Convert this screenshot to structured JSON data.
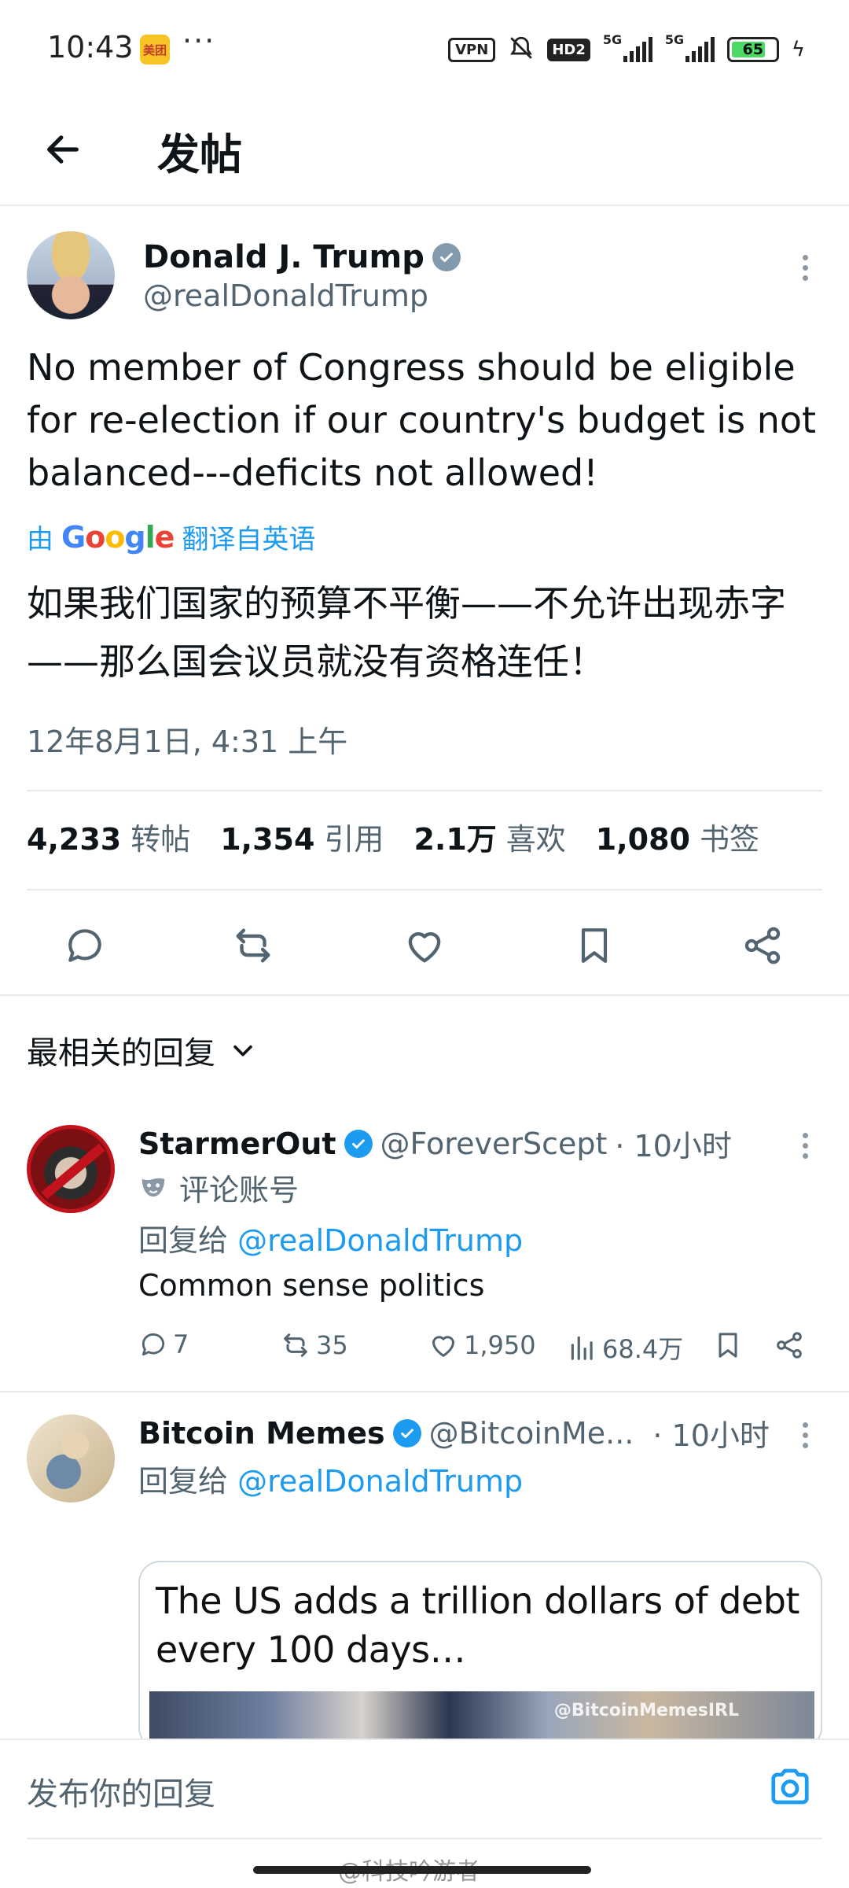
{
  "status_bar": {
    "time": "10:43",
    "app_badge": "美团",
    "more": "···",
    "vpn": "VPN",
    "hd": "HD2",
    "signal1": "5G",
    "signal2": "5G",
    "battery": "65"
  },
  "header": {
    "title": "发帖"
  },
  "tweet": {
    "author_name": "Donald J. Trump",
    "author_handle": "@realDonaldTrump",
    "text": "No member of Congress should be eligible for re-election if our country's budget is not balanced---deficits not allowed!",
    "translate_prefix": "由",
    "translate_suffix": "翻译自英语",
    "translated_text": "如果我们国家的预算不平衡——不允许出现赤字——那么国会议员就没有资格连任！",
    "timestamp": "12年8月1日, 4:31 上午",
    "stats": [
      {
        "value": "4,233",
        "label": "转帖"
      },
      {
        "value": "1,354",
        "label": "引用"
      },
      {
        "value": "2.1万",
        "label": "喜欢"
      },
      {
        "value": "1,080",
        "label": "书签"
      }
    ]
  },
  "replies_header": "最相关的回复",
  "replies": [
    {
      "name": "StarmerOut",
      "handle": "@ForeverScept",
      "time": "· 10小时",
      "label": "评论账号",
      "reply_prefix": "回复给",
      "reply_mention": "@realDonaldTrump",
      "text": "Common sense politics",
      "comments": "7",
      "retweets": "35",
      "likes": "1,950",
      "views": "68.4万"
    },
    {
      "name": "Bitcoin Memes",
      "handle": "@BitcoinMe...",
      "time": "· 10小时",
      "reply_prefix": "回复给",
      "reply_mention": "@realDonaldTrump",
      "media_caption": "The US adds a trillion dollars of debt every 100 days…",
      "media_watermark": "@BitcoinMemesIRL"
    }
  ],
  "compose": {
    "placeholder": "发布你的回复"
  },
  "watermark": "@科技吟游者",
  "colors": {
    "accent": "#1d9bf0",
    "text": "#0f1419",
    "secondary": "#536471",
    "divider": "#e7e9ea"
  }
}
